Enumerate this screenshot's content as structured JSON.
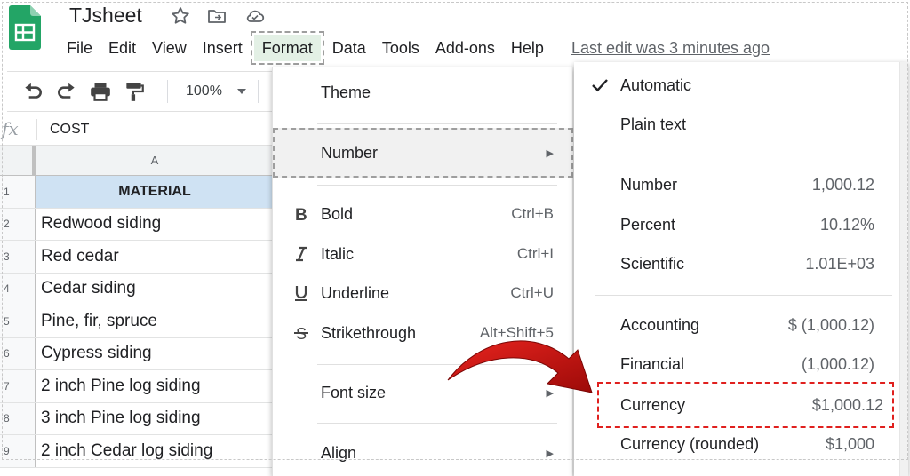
{
  "app": {
    "title": "TJsheet",
    "last_edit": "Last edit was 3 minutes ago"
  },
  "menubar": {
    "items": [
      "File",
      "Edit",
      "View",
      "Insert",
      "Format",
      "Data",
      "Tools",
      "Add-ons",
      "Help"
    ],
    "active": "Format"
  },
  "toolbar": {
    "zoom": "100%"
  },
  "formula_bar": {
    "fx": "fx",
    "value": "COST"
  },
  "grid": {
    "column_header": "A",
    "rows": [
      {
        "num": "1",
        "value": "MATERIAL"
      },
      {
        "num": "2",
        "value": "Redwood siding"
      },
      {
        "num": "3",
        "value": "Red cedar"
      },
      {
        "num": "4",
        "value": "Cedar siding"
      },
      {
        "num": "5",
        "value": "Pine, fir, spruce"
      },
      {
        "num": "6",
        "value": "Cypress siding"
      },
      {
        "num": "7",
        "value": "2 inch Pine log siding"
      },
      {
        "num": "8",
        "value": "3 inch Pine log siding"
      },
      {
        "num": "9",
        "value": "2 inch Cedar log siding"
      }
    ]
  },
  "format_menu": {
    "theme": "Theme",
    "number": "Number",
    "bold": {
      "label": "Bold",
      "shortcut": "Ctrl+B"
    },
    "italic": {
      "label": "Italic",
      "shortcut": "Ctrl+I"
    },
    "underline": {
      "label": "Underline",
      "shortcut": "Ctrl+U"
    },
    "strikethrough": {
      "label": "Strikethrough",
      "shortcut": "Alt+Shift+5"
    },
    "font_size": "Font size",
    "align": "Align"
  },
  "number_menu": {
    "automatic": "Automatic",
    "plain_text": "Plain text",
    "number": {
      "label": "Number",
      "value": "1,000.12"
    },
    "percent": {
      "label": "Percent",
      "value": "10.12%"
    },
    "scientific": {
      "label": "Scientific",
      "value": "1.01E+03"
    },
    "accounting": {
      "label": "Accounting",
      "value": "$ (1,000.12)"
    },
    "financial": {
      "label": "Financial",
      "value": "(1,000.12)"
    },
    "currency": {
      "label": "Currency",
      "value": "$1,000.12"
    },
    "currency_rounded": {
      "label": "Currency (rounded)",
      "value": "$1,000"
    }
  },
  "colors": {
    "accent_green": "#188038",
    "header_fill": "#cfe2f3",
    "highlight_red": "#e0201e",
    "arrow_red": "#c8100e"
  }
}
